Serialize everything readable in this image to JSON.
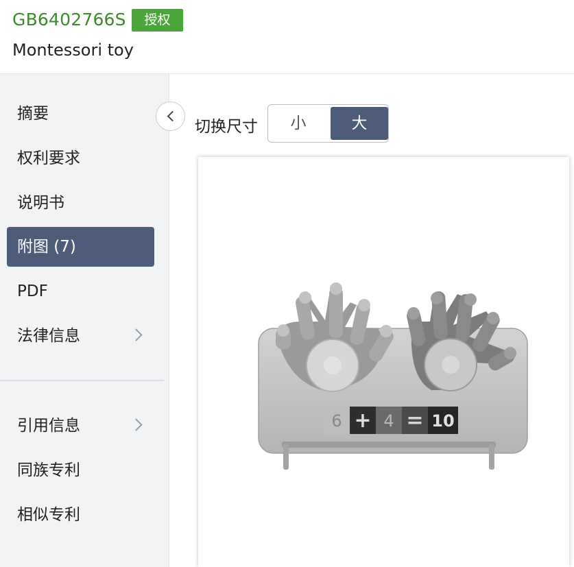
{
  "header": {
    "publication_number": "GB6402766S",
    "status_badge": "授权",
    "title": "Montessori toy"
  },
  "sidebar": {
    "items": [
      {
        "label": "摘要"
      },
      {
        "label": "权利要求"
      },
      {
        "label": "说明书"
      },
      {
        "label": "附图 (7)",
        "active": true
      },
      {
        "label": "PDF"
      },
      {
        "label": "法律信息",
        "has_submenu": true
      }
    ],
    "secondary_items": [
      {
        "label": "引用信息",
        "has_submenu": true
      },
      {
        "label": "同族专利"
      },
      {
        "label": "相似专利"
      }
    ],
    "collapse_icon": "chevron-left-icon"
  },
  "viewer": {
    "size_label": "切换尺寸",
    "size_options": [
      "小",
      "大"
    ],
    "selected_size": "大",
    "figure": {
      "tiles": [
        "6",
        "+",
        "4",
        "=",
        "10"
      ]
    }
  },
  "colors": {
    "brand_green": "#3b8a2b",
    "badge_green": "#4aa63a",
    "active_nav": "#4d5c78"
  }
}
